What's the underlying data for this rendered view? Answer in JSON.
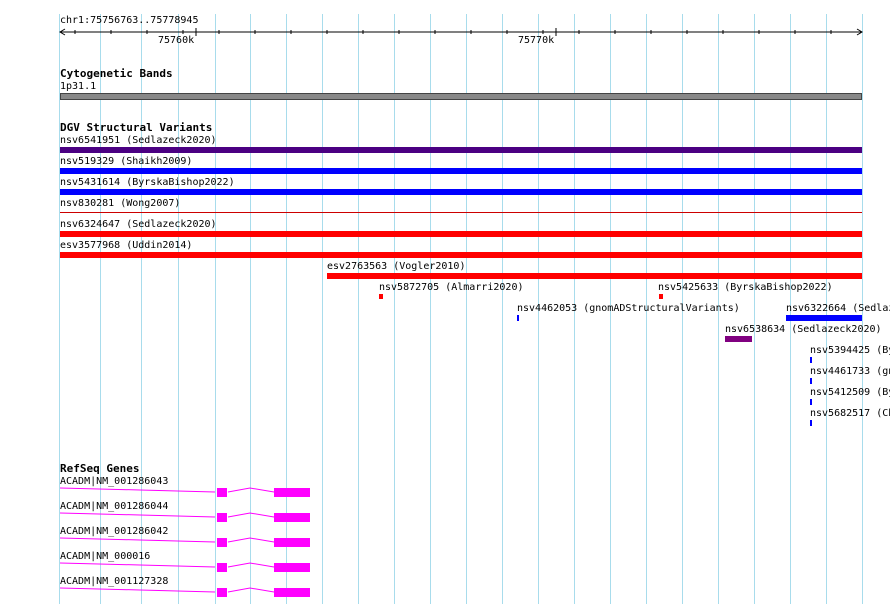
{
  "locus": "chr1:75756763..75778945",
  "ruler": {
    "ticks": [
      "75760k",
      "75770k"
    ]
  },
  "colors": {
    "grid": "#a8dcec",
    "cytoband": "#888888",
    "dark_purple": "#4b0082",
    "blue": "#0000ff",
    "red": "#ff0000",
    "purple": "#800080",
    "magenta": "#ff00ff"
  },
  "tracks": {
    "cytobands": {
      "title": "Cytogenetic Bands",
      "band": "1p31.1"
    },
    "dgv": {
      "title": "DGV Structural Variants",
      "features": [
        {
          "label": "nsv6541951 (Sedlazeck2020)"
        },
        {
          "label": "nsv519329 (Shaikh2009)"
        },
        {
          "label": "nsv5431614 (ByrskaBishop2022)"
        },
        {
          "label": "nsv830281 (Wong2007)"
        },
        {
          "label": "nsv6324647 (Sedlazeck2020)"
        },
        {
          "label": "esv3577968 (Uddin2014)"
        },
        {
          "label": "esv2763563 (Vogler2010)"
        },
        {
          "label": "nsv5872705 (Almarri2020)"
        },
        {
          "label": "nsv5425633 (ByrskaBishop2022)"
        },
        {
          "label": "nsv4462053 (gnomADStructuralVariants)"
        },
        {
          "label": "nsv6322664 (Sedlaz"
        },
        {
          "label": "nsv6538634 (Sedlazeck2020)"
        },
        {
          "label": "nsv5394425 (By"
        },
        {
          "label": "nsv4461733 (gn"
        },
        {
          "label": "nsv5412509 (By"
        },
        {
          "label": "nsv5682517 (Ch"
        }
      ]
    },
    "refseq": {
      "title": "RefSeq Genes",
      "genes": [
        {
          "label": "ACADM|NM_001286043"
        },
        {
          "label": "ACADM|NM_001286044"
        },
        {
          "label": "ACADM|NM_001286042"
        },
        {
          "label": "ACADM|NM_000016"
        },
        {
          "label": "ACADM|NM_001127328"
        }
      ]
    }
  }
}
